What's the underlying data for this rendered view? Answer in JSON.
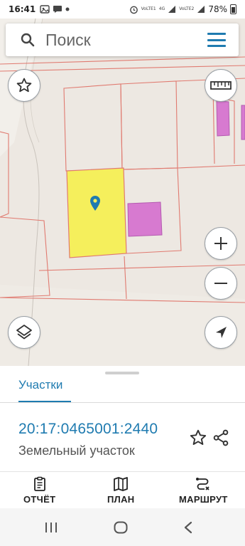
{
  "status_bar": {
    "time": "16:41",
    "network_1": "VoLTE1",
    "network_speed": "4G",
    "network_2": "VoLTE2",
    "battery": "78%"
  },
  "search": {
    "placeholder": "Поиск"
  },
  "map": {
    "selected_parcel_color": "#f5ef5c",
    "building_color": "#d77ad0",
    "boundary_color": "#e07a70"
  },
  "sheet": {
    "tab_label": "Участки",
    "parcel_number": "20:17:0465001:2440",
    "parcel_type": "Земельный участок"
  },
  "actions": {
    "report_label": "ОТЧЁТ",
    "plan_label": "ПЛАН",
    "route_label": "МАРШРУТ"
  },
  "colors": {
    "accent": "#1f7bb0"
  }
}
